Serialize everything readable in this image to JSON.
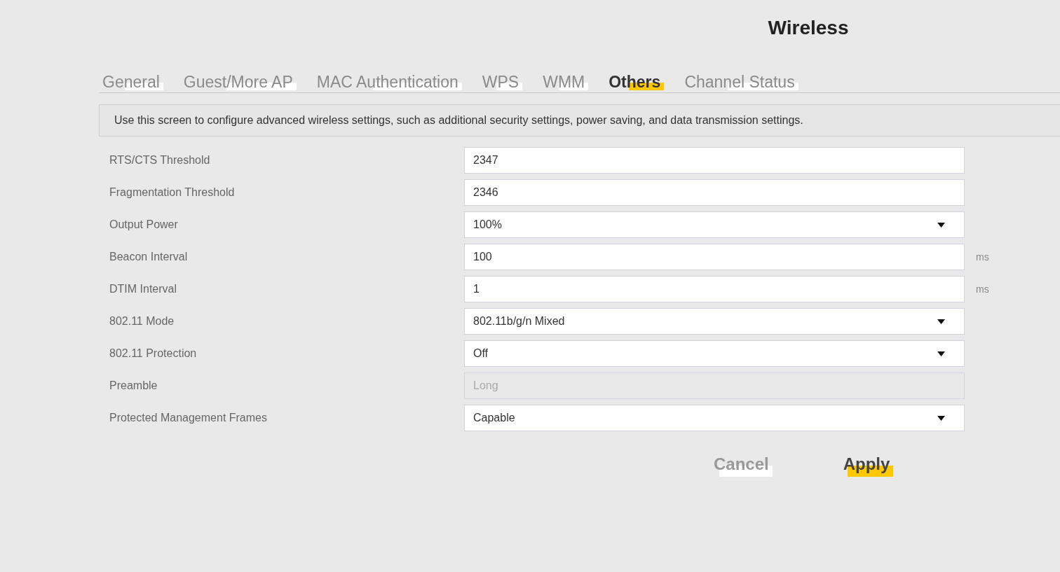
{
  "page_title": "Wireless",
  "tabs": [
    {
      "label": "General",
      "selected": false
    },
    {
      "label": "Guest/More AP",
      "selected": false
    },
    {
      "label": "MAC Authentication",
      "selected": false
    },
    {
      "label": "WPS",
      "selected": false
    },
    {
      "label": "WMM",
      "selected": false
    },
    {
      "label": "Others",
      "selected": true
    },
    {
      "label": "Channel Status",
      "selected": false
    }
  ],
  "description": "Use this screen to configure advanced wireless settings, such as additional security settings, power saving, and data transmission settings.",
  "fields": [
    {
      "label": "RTS/CTS Threshold",
      "kind": "input",
      "value": "2347",
      "disabled": false
    },
    {
      "label": "Fragmentation Threshold",
      "kind": "input",
      "value": "2346",
      "disabled": false
    },
    {
      "label": "Output Power",
      "kind": "select",
      "value": "100%",
      "disabled": false
    },
    {
      "label": "Beacon Interval",
      "kind": "input",
      "value": "100",
      "unit": "ms",
      "disabled": false
    },
    {
      "label": "DTIM Interval",
      "kind": "input",
      "value": "1",
      "unit": "ms",
      "disabled": false
    },
    {
      "label": "802.11 Mode",
      "kind": "select",
      "value": "802.11b/g/n Mixed",
      "disabled": false
    },
    {
      "label": "802.11 Protection",
      "kind": "select",
      "value": "Off",
      "disabled": false
    },
    {
      "label": "Preamble",
      "kind": "input",
      "value": "Long",
      "disabled": true
    },
    {
      "label": "Protected Management Frames",
      "kind": "select",
      "value": "Capable",
      "disabled": false
    }
  ],
  "buttons": [
    {
      "label": "Cancel",
      "kind": "secondary"
    },
    {
      "label": "Apply",
      "kind": "primary"
    }
  ]
}
